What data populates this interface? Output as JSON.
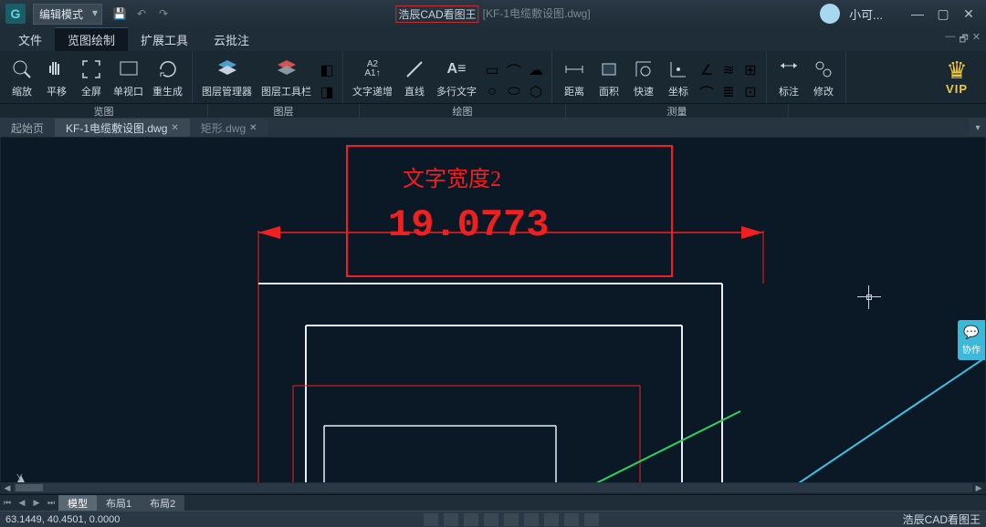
{
  "title": {
    "mode": "编辑模式",
    "app": "浩辰CAD看图王",
    "file": "[KF-1电缆敷设图.dwg]",
    "user": "小可..."
  },
  "menus": {
    "file": "文件",
    "view": "览图绘制",
    "ext": "扩展工具",
    "cloud": "云批注"
  },
  "ribbon": {
    "groups": {
      "view": "览图",
      "layer": "图层",
      "draw": "绘图",
      "measure": "测量"
    },
    "btns": {
      "zoom": "缩放",
      "pan": "平移",
      "full": "全屏",
      "vp": "单视口",
      "regen": "重生成",
      "laymgr": "图层管理器",
      "laytool": "图层工具栏",
      "textinc": "文字递增",
      "line": "直线",
      "mtext": "多行文字",
      "dist": "距离",
      "area": "面积",
      "quick": "快速",
      "coord": "坐标",
      "annot": "标注",
      "modify": "修改",
      "vip": "VIP"
    }
  },
  "doctabs": {
    "start": "起始页",
    "t1": "KF-1电缆敷设图.dwg",
    "t2": "矩形.dwg"
  },
  "canvas": {
    "label": "文字宽度2",
    "dimValue": "19.0773"
  },
  "collab": "协作",
  "layouts": {
    "model": "模型",
    "lay1": "布局1",
    "lay2": "布局2"
  },
  "status": {
    "coords": "63.1449, 40.4501, 0.0000",
    "brand": "浩辰CAD看图王"
  }
}
